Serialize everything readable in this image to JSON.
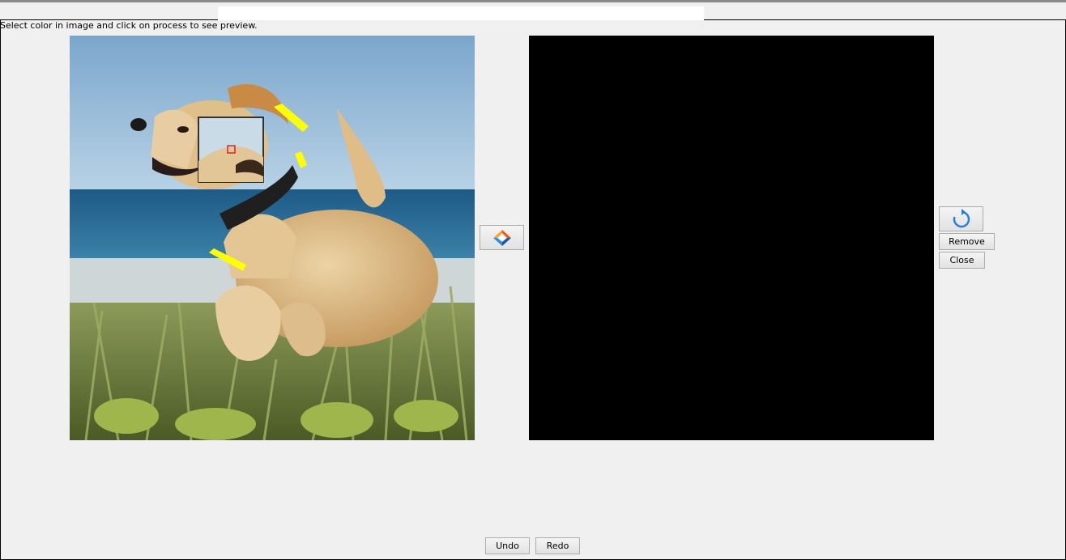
{
  "window": {
    "instruction": "Select color in image and click on process to see preview."
  },
  "editor": {
    "source_image": "dog-running-on-beach-photo",
    "preview_image": "black-preview"
  },
  "buttons": {
    "process_icon": "process-icon",
    "reset_icon": "rotate-reset-icon",
    "remove_label": "Remove",
    "close_label": "Close",
    "undo_label": "Undo",
    "redo_label": "Redo"
  },
  "colors": {
    "selection_marker": "#ffff00",
    "magnifier_center": "#d80000",
    "preview_background": "#000000",
    "reset_icon": "#1e7fe0"
  }
}
